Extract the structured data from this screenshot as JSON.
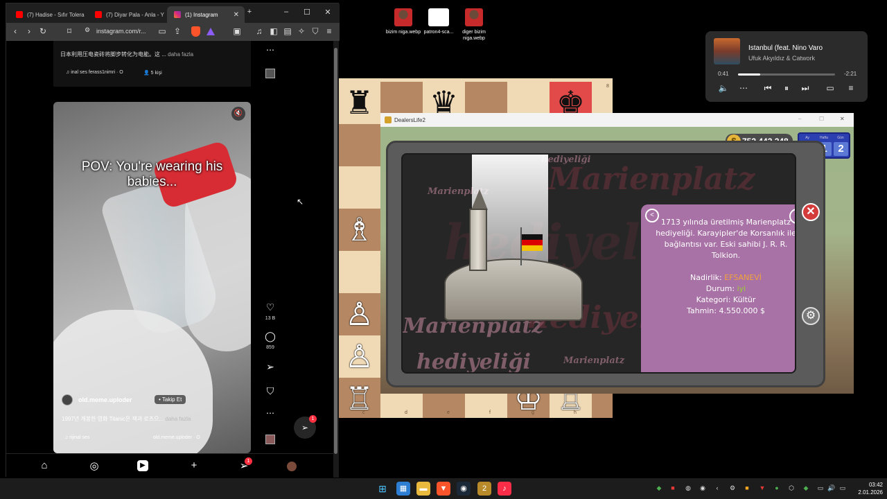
{
  "browser": {
    "tabs": [
      {
        "title": "(7) Hadise - Sıfır Tolera",
        "favicon": "youtube-icon"
      },
      {
        "title": "(7) Diyar Pala - Anla - Y",
        "favicon": "youtube-icon"
      },
      {
        "title": "(1) Instagram",
        "favicon": "instagram-icon"
      }
    ],
    "url": "instagram.com/r...",
    "window_controls": {
      "minimize": "–",
      "maximize": "☐",
      "close": "✕"
    }
  },
  "instagram": {
    "prev_post": {
      "caption": "日本利用压电瓷砖将脚步转化为电能。这 ...",
      "more": "daha fazla",
      "audio": "inal ses  ferass1nimri · O",
      "people": "5 kişi"
    },
    "reel": {
      "overlay_text": "POV: You're wearing his babies...",
      "username": "old.meme.uploder",
      "follow_label": "Takip Et",
      "description": "1997년 개봉한 영화 Titanic은 잭과 로즈으...",
      "more": "daha fazla",
      "audio_left": "rijinal ses",
      "audio_right": "old.meme.uploder · O",
      "likes": "13 B",
      "comments": "859",
      "notif_count": "1"
    },
    "bottom_nav_badge": "1"
  },
  "desktop_icons": [
    {
      "label": "bizim niga.webp"
    },
    {
      "label": "patron4-sca..."
    },
    {
      "label": "diger bizim niga.webp"
    }
  ],
  "media": {
    "title": "İstanbul (feat. Nino Varo",
    "artist": "Ufuk Akyıldız & Catwork",
    "elapsed": "0:41",
    "remaining": "-2:21",
    "progress": 0.23
  },
  "chess": {
    "files": [
      "c",
      "d",
      "e",
      "f",
      "g",
      "h"
    ],
    "rank_label": "8"
  },
  "game": {
    "window_title": "DealersLife2",
    "money": "752.442.248",
    "date_labels": [
      "Ay",
      "Hafta",
      "Gün"
    ],
    "date_values": [
      "85",
      "1",
      "2"
    ],
    "watermarks": [
      "Marienplatz",
      "hediyeliği",
      "Marienplatz",
      "hediyeliği",
      "Marienplatz",
      "hediyeliği",
      "Marienplatz",
      "hediyeliği"
    ],
    "item": {
      "description": "1713 yılında üretilmiş Marienplatz hediyeliği. Karayipler'de Korsanlık ile bağlantısı var. Eski sahibi J. R. R. Tolkion.",
      "rarity_label": "Nadirlik:",
      "rarity_value": "EFSANEVİ",
      "condition_label": "Durum:",
      "condition_value": "iyi",
      "category": "Kategori: Kültür",
      "estimate": "Tahmin: 4.550.000 $",
      "search_count": "2"
    }
  },
  "clock": {
    "time": "03:42",
    "date": "2.01.2026"
  }
}
